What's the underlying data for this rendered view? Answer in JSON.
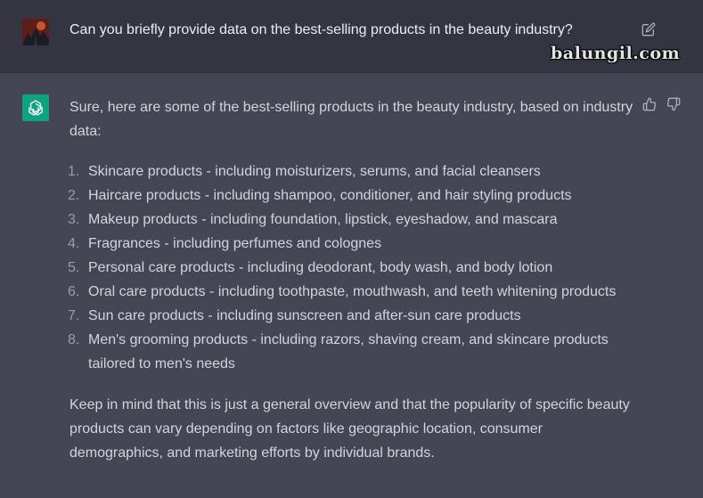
{
  "user_message": "Can you briefly provide data on the best-selling products in the beauty industry?",
  "watermark": "balungil.com",
  "assistant": {
    "intro": "Sure, here are some of the best-selling products in the beauty industry, based on industry data:",
    "items": [
      {
        "num": "1.",
        "text": "Skincare products - including moisturizers, serums, and facial cleansers"
      },
      {
        "num": "2.",
        "text": "Haircare products - including shampoo, conditioner, and hair styling products"
      },
      {
        "num": "3.",
        "text": "Makeup products - including foundation, lipstick, eyeshadow, and mascara"
      },
      {
        "num": "4.",
        "text": "Fragrances - including perfumes and colognes"
      },
      {
        "num": "5.",
        "text": "Personal care products - including deodorant, body wash, and body lotion"
      },
      {
        "num": "6.",
        "text": "Oral care products - including toothpaste, mouthwash, and teeth whitening products"
      },
      {
        "num": "7.",
        "text": "Sun care products - including sunscreen and after-sun care products"
      },
      {
        "num": "8.",
        "text": "Men's grooming products - including razors, shaving cream, and skincare products tailored to men's needs"
      }
    ],
    "outro": "Keep in mind that this is just a general overview and that the popularity of specific beauty products can vary depending on factors like geographic location, consumer demographics, and marketing efforts by individual brands."
  },
  "colors": {
    "user_bg": "#343541",
    "assistant_bg": "#444654",
    "bot_avatar": "#10a37f",
    "text": "#d1d5db"
  },
  "icons": {
    "edit": "edit-icon",
    "thumbs_up": "thumbs-up-icon",
    "thumbs_down": "thumbs-down-icon",
    "bot_logo": "openai-logo-icon"
  }
}
